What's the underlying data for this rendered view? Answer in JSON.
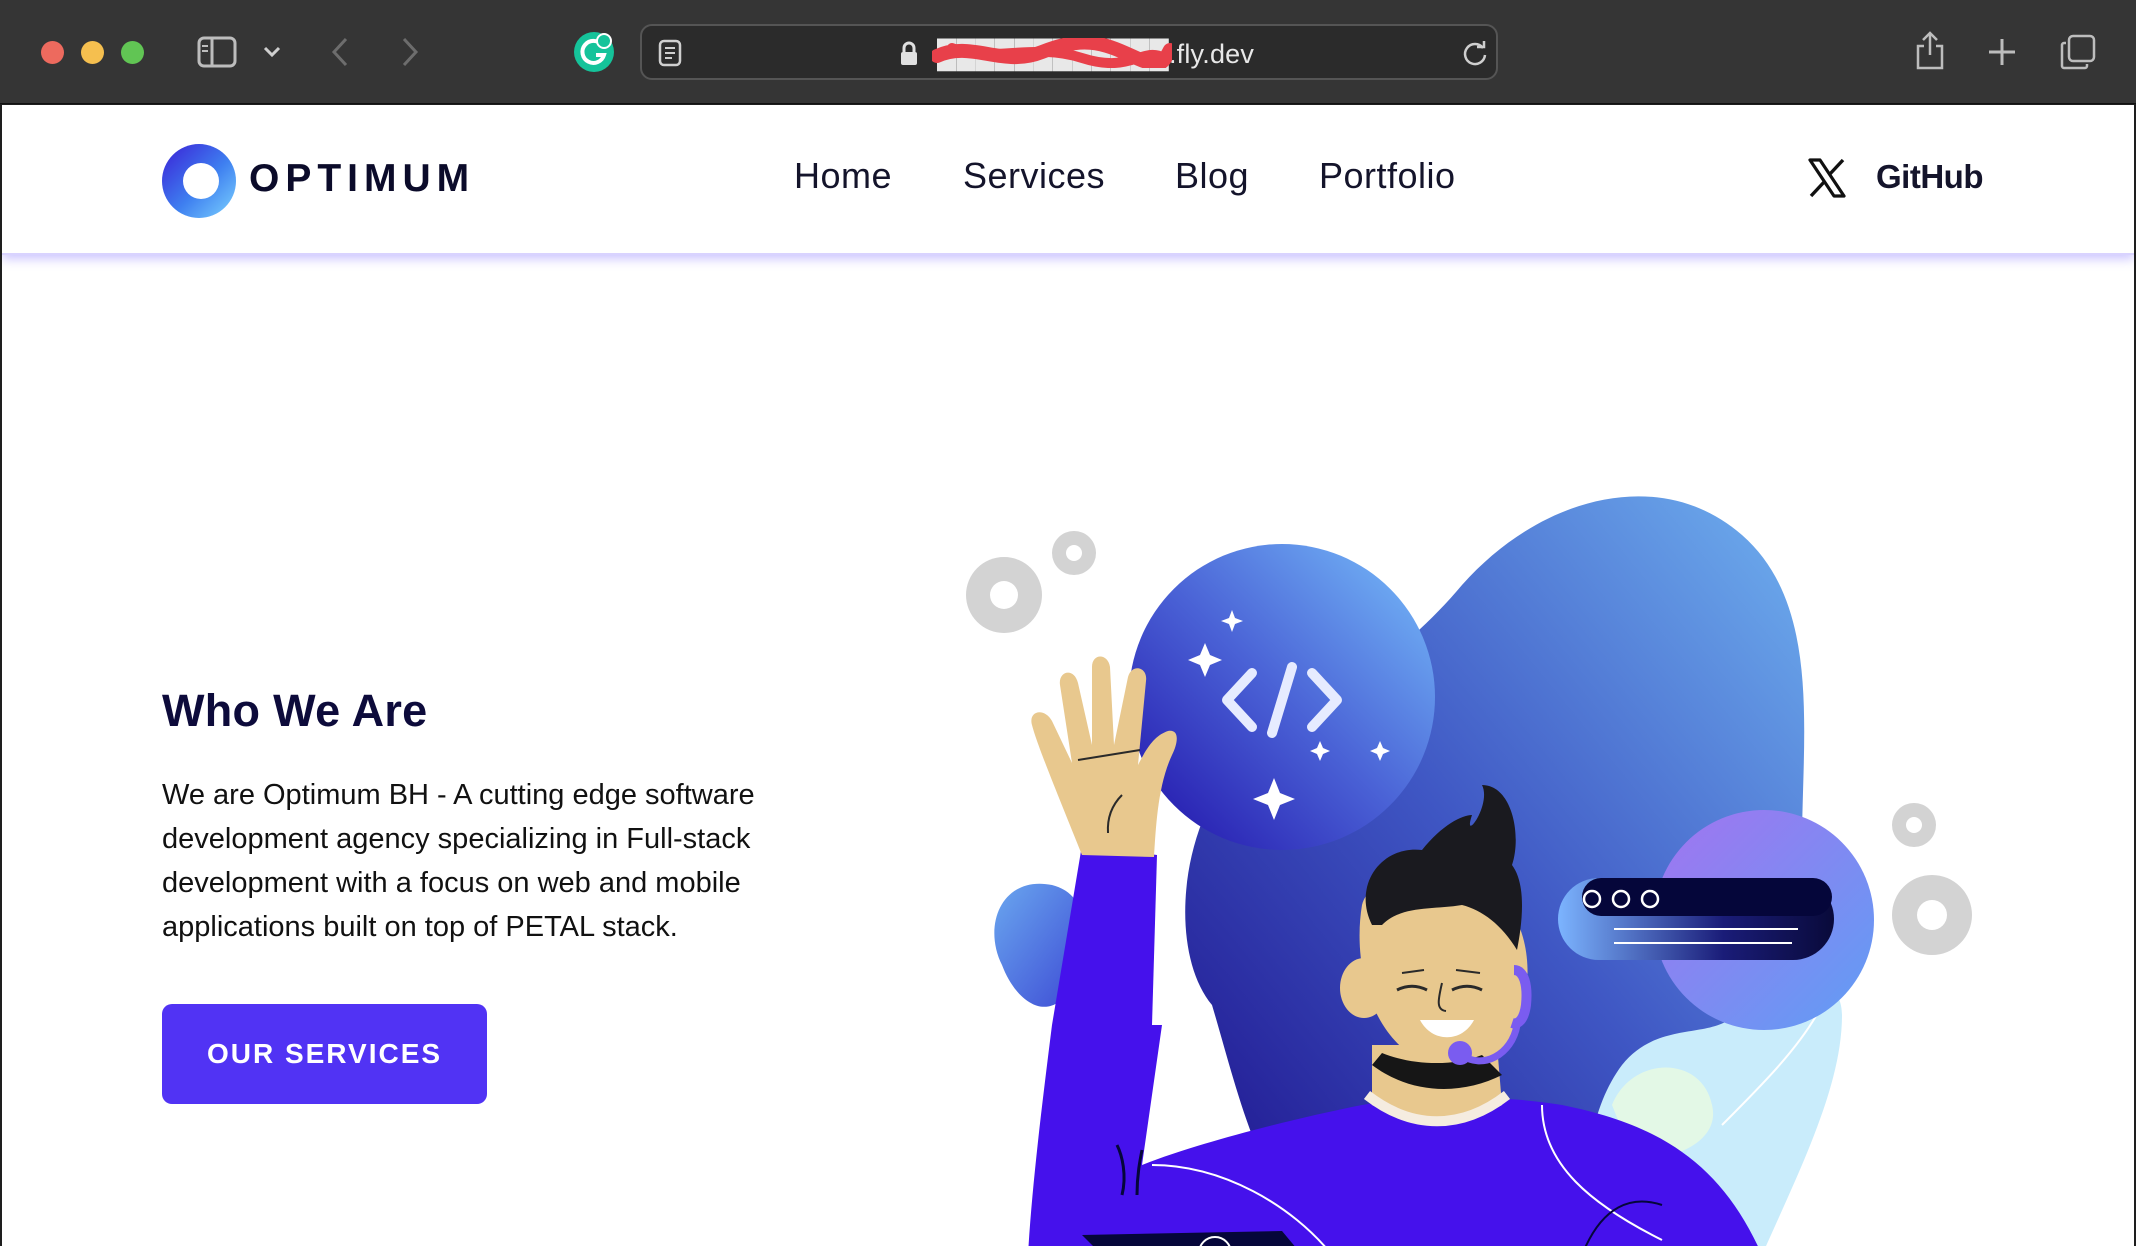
{
  "browser": {
    "url": "fly.dev",
    "url_display": "████████████.fly.dev",
    "icons": [
      "sidebar-icon",
      "chevron-down-icon",
      "back-icon",
      "forward-icon",
      "grammarly-icon",
      "reader-icon",
      "lock-icon",
      "reload-icon",
      "share-icon",
      "new-tab-icon",
      "tabs-overview-icon"
    ]
  },
  "nav": {
    "logo_text": "OPTIMUM",
    "links": [
      "Home",
      "Services",
      "Blog",
      "Portfolio"
    ],
    "github_label": "GitHub"
  },
  "hero": {
    "title": "Who We Are",
    "description": "We are Optimum BH - A cutting edge software development agency specializing in Full-stack development with a focus on web and mobile applications built on top of PETAL stack.",
    "cta_label": "OUR SERVICES"
  },
  "colors": {
    "accent": "#5133f4",
    "heading": "#0d0b3b",
    "chrome": "#353535"
  }
}
